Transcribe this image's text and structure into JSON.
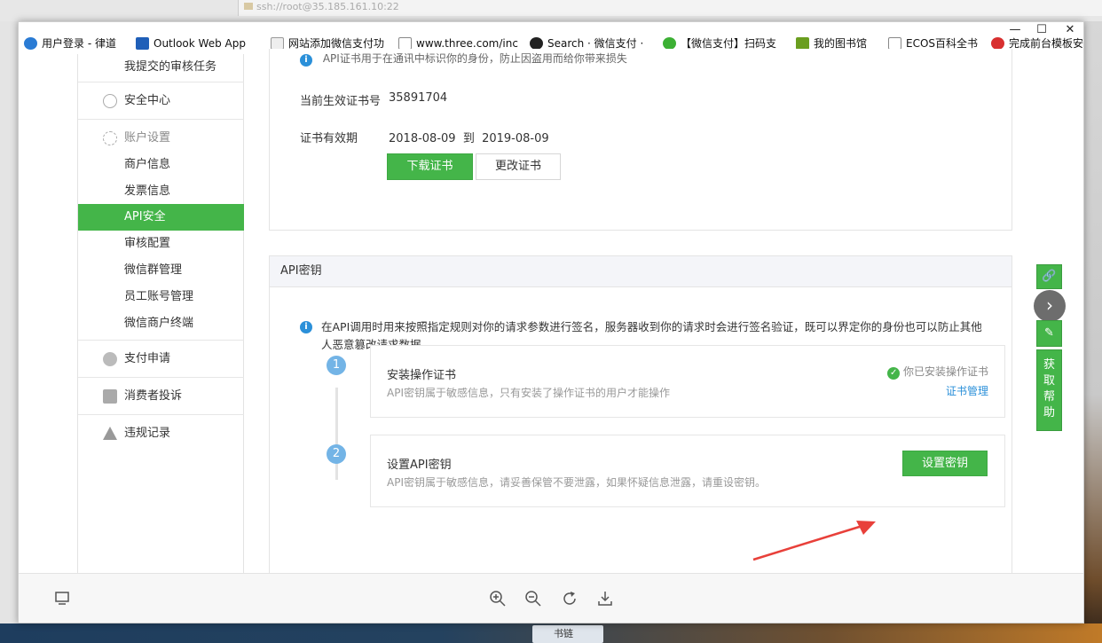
{
  "background": {
    "ssh_title": "ssh://root@35.185.161.10:22",
    "task_item": "书链"
  },
  "window_controls": {
    "minimize": "—",
    "maximize": "☐",
    "close": "✕"
  },
  "bookmarks": [
    {
      "label": "用户登录 - 律道",
      "color": "#2a7bd4"
    },
    {
      "label": "Outlook Web App",
      "color": "#1f5fb8"
    },
    {
      "label": "网站添加微信支付功",
      "color": "#888888"
    },
    {
      "label": "www.three.com/inc",
      "color": "#dddddd"
    },
    {
      "label": "Search · 微信支付 ·",
      "color": "#222222"
    },
    {
      "label": "【微信支付】扫码支",
      "color": "#3cb034"
    },
    {
      "label": "我的图书馆",
      "color": "#6a9e1f"
    },
    {
      "label": "ECOS百科全书",
      "color": "#dddddd"
    },
    {
      "label": "完成前台模板安",
      "color": "#d82f2f"
    }
  ],
  "sidebar": {
    "items": [
      {
        "label": "我提交的审核任务",
        "type": "sub"
      },
      {
        "label": "安全中心",
        "type": "main",
        "icon": "shield-icon"
      },
      {
        "label": "账户设置",
        "type": "head",
        "icon": "gear-icon"
      },
      {
        "label": "商户信息",
        "type": "sub"
      },
      {
        "label": "发票信息",
        "type": "sub"
      },
      {
        "label": "API安全",
        "type": "sub",
        "active": true
      },
      {
        "label": "审核配置",
        "type": "sub"
      },
      {
        "label": "微信群管理",
        "type": "sub"
      },
      {
        "label": "员工账号管理",
        "type": "sub"
      },
      {
        "label": "微信商户终端",
        "type": "sub"
      },
      {
        "label": "支付申请",
        "type": "main",
        "icon": "card-icon"
      },
      {
        "label": "消费者投诉",
        "type": "main",
        "icon": "chat-icon"
      },
      {
        "label": "违规记录",
        "type": "main",
        "icon": "warning-icon"
      }
    ]
  },
  "cert_panel": {
    "notice": "API证书用于在通讯中标识你的身份，防止因盗用而给你带来损失",
    "serial_label": "当前生效证书号",
    "serial_value": "35891704",
    "validity_label": "证书有效期",
    "validity_value": "2018-08-09  到  2019-08-09",
    "download_button": "下载证书",
    "change_button": "更改证书"
  },
  "key_panel": {
    "title": "API密钥",
    "notice": "在API调用时用来按照指定规则对你的请求参数进行签名，服务器收到你的请求时会进行签名验证，既可以界定你的身份也可以防止其他人恶意篡改请求数据。",
    "steps": [
      {
        "num": "1",
        "title": "安装操作证书",
        "desc": "API密钥属于敏感信息，只有安装了操作证书的用户才能操作",
        "status": "你已安装操作证书",
        "link": "证书管理"
      },
      {
        "num": "2",
        "title": "设置API密钥",
        "desc": "API密钥属于敏感信息，请妥善保管不要泄露，如果怀疑信息泄露，请重设密钥。",
        "button": "设置密钥"
      }
    ]
  },
  "help_widget": {
    "label": "获取帮助"
  },
  "viewer_toolbar": {
    "icons": [
      "monitor-icon",
      "zoom-in-icon",
      "zoom-out-icon",
      "rotate-icon",
      "download-icon"
    ]
  },
  "colors": {
    "accent": "#44b549",
    "info": "#2b90d9",
    "step": "#73b4e6",
    "arrow": "#e8403a"
  }
}
